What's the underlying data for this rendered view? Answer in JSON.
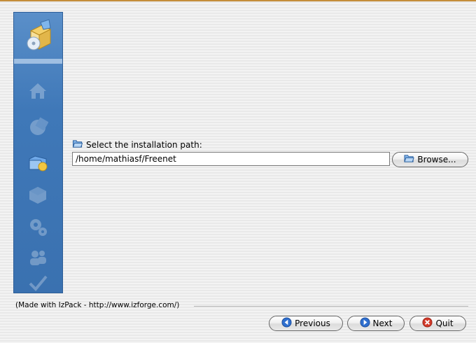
{
  "wizard": {
    "prompt_label": "Select the installation path:",
    "path_value": "/home/mathiasf/Freenet",
    "browse_label": "Browse...",
    "footer_text": "(Made with IzPack - http://www.izforge.com/)",
    "buttons": {
      "previous": "Previous",
      "next": "Next",
      "quit": "Quit"
    }
  },
  "steps": [
    {
      "icon": "install-box-icon",
      "state": "header"
    },
    {
      "icon": "home-icon",
      "state": "done"
    },
    {
      "icon": "license-globe-icon",
      "state": "done"
    },
    {
      "icon": "folder-target-icon",
      "state": "current"
    },
    {
      "icon": "packages-icon",
      "state": "pending"
    },
    {
      "icon": "gears-icon",
      "state": "pending"
    },
    {
      "icon": "users-icon",
      "state": "pending"
    },
    {
      "icon": "checkmark-icon",
      "state": "pending"
    }
  ],
  "colors": {
    "panel_blue": "#3f78b8",
    "top_border": "#c58e3a",
    "previous_icon": "#2f6fcf",
    "next_icon": "#2f6fcf",
    "quit_icon": "#d23a2a"
  }
}
